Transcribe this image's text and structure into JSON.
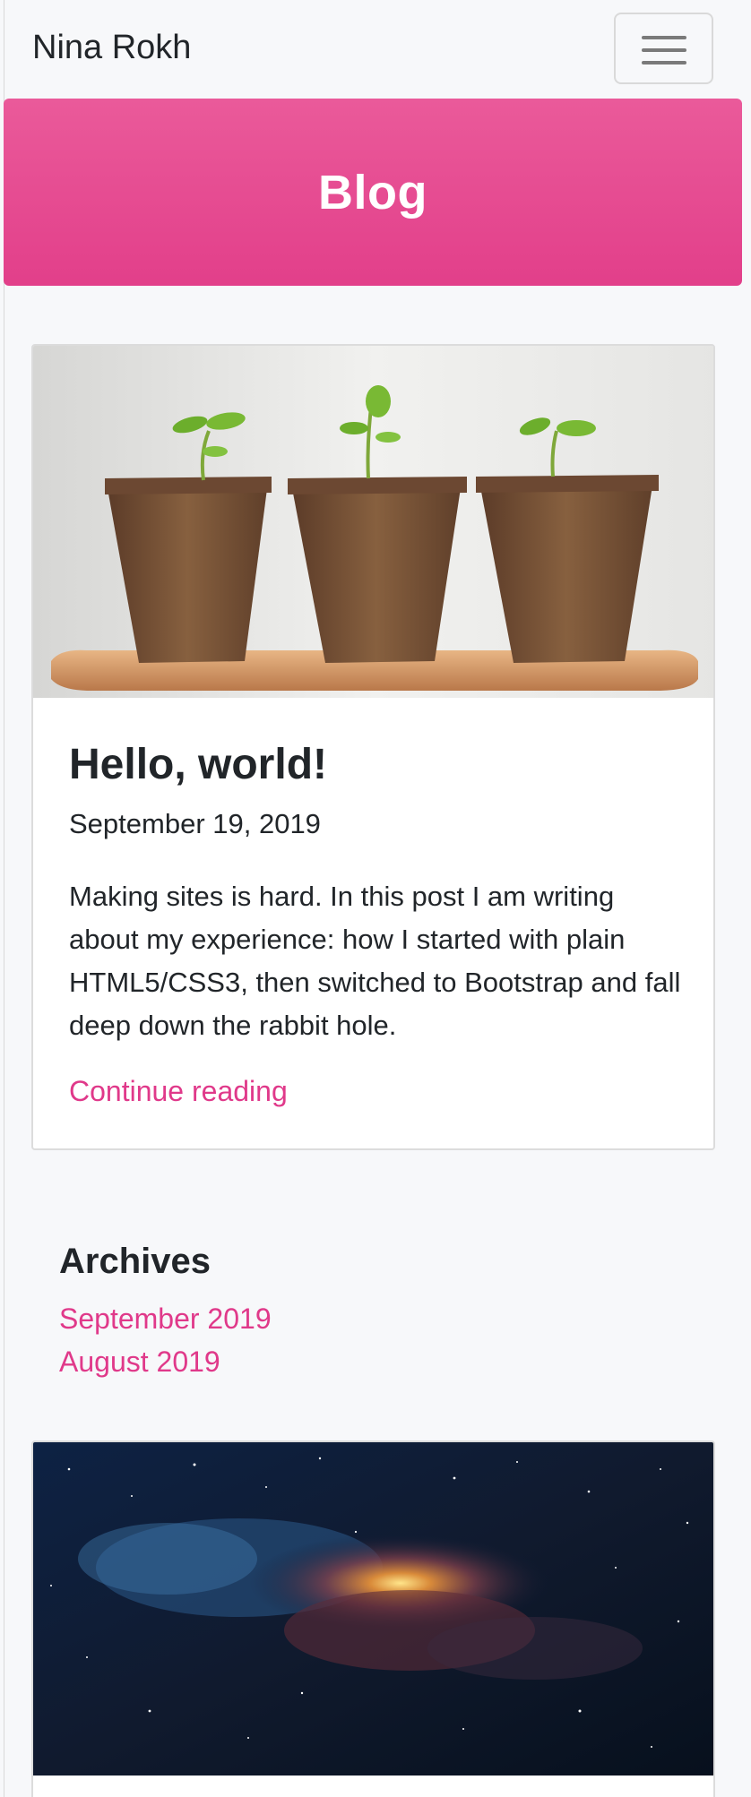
{
  "navbar": {
    "brand": "Nina Rokh",
    "toggle_icon": "hamburger-menu-icon"
  },
  "hero": {
    "title": "Blog",
    "colors": {
      "top": "#ea5a9a",
      "bottom": "#e23f8a"
    }
  },
  "posts": [
    {
      "image": "seedlings-in-peat-pots",
      "title": "Hello, world!",
      "date": "September 19, 2019",
      "excerpt": "Making sites is hard. In this post I am writing about my experience: how I started with plain HTML5/CSS3, then switched to Bootstrap and fall deep down the rabbit hole.",
      "link": "Continue reading"
    },
    {
      "image": "milky-way-night-sky"
    }
  ],
  "archives": {
    "heading": "Archives",
    "items": [
      "September 2019",
      "August 2019"
    ]
  },
  "colors": {
    "accent": "#e0398a",
    "background": "#f7f8fa",
    "text": "#212529"
  }
}
